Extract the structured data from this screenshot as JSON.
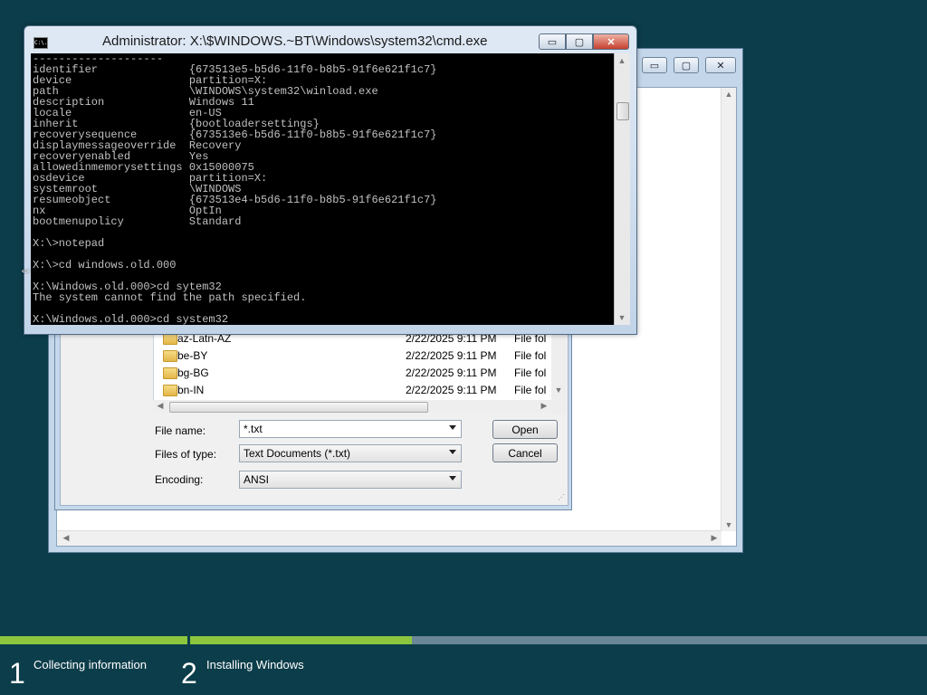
{
  "cmd": {
    "title": "Administrator: X:\\$WINDOWS.~BT\\Windows\\system32\\cmd.exe",
    "icon_text": "C:\\.",
    "lines": [
      "--------------------",
      "identifier              {673513e5-b5d6-11f0-b8b5-91f6e621f1c7}",
      "device                  partition=X:",
      "path                    \\WINDOWS\\system32\\winload.exe",
      "description             Windows 11",
      "locale                  en-US",
      "inherit                 {bootloadersettings}",
      "recoverysequence        {673513e6-b5d6-11f0-b8b5-91f6e621f1c7}",
      "displaymessageoverride  Recovery",
      "recoveryenabled         Yes",
      "allowedinmemorysettings 0x15000075",
      "osdevice                partition=X:",
      "systemroot              \\WINDOWS",
      "resumeobject            {673513e4-b5d6-11f0-b8b5-91f6e621f1c7}",
      "nx                      OptIn",
      "bootmenupolicy          Standard",
      "",
      "X:\\>notepad",
      "",
      "X:\\>cd windows.old.000",
      "",
      "X:\\Windows.old.000>cd sytem32",
      "The system cannot find the path specified.",
      "",
      "X:\\Windows.old.000>cd system32"
    ]
  },
  "dialog": {
    "files": [
      {
        "name": "az-Latn-AZ",
        "date": "2/22/2025 9:11 PM",
        "type": "File fol"
      },
      {
        "name": "be-BY",
        "date": "2/22/2025 9:11 PM",
        "type": "File fol"
      },
      {
        "name": "bg-BG",
        "date": "2/22/2025 9:11 PM",
        "type": "File fol"
      },
      {
        "name": "bn-IN",
        "date": "2/22/2025 9:11 PM",
        "type": "File fol"
      }
    ],
    "file_name_label": "File name:",
    "file_name_value": "*.txt",
    "files_of_type_label": "Files of type:",
    "files_of_type_value": "Text Documents (*.txt)",
    "encoding_label": "Encoding:",
    "encoding_value": "ANSI",
    "open_label": "Open",
    "cancel_label": "Cancel"
  },
  "setup": {
    "progress": 0.444,
    "accent_color": "#8cc63f",
    "steps": [
      {
        "number": "1",
        "label": "Collecting information"
      },
      {
        "number": "2",
        "label": "Installing Windows"
      }
    ]
  },
  "icons": {
    "minimize": "minimize-icon",
    "maximize": "maximize-icon",
    "close": "close-icon",
    "folder": "folder-icon",
    "cursor": "resize-cursor-icon"
  }
}
